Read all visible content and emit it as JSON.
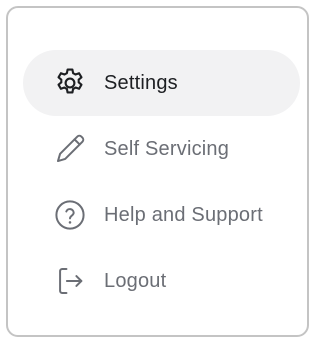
{
  "menu": {
    "items": [
      {
        "label": "Settings",
        "icon": "gear-icon",
        "active": true
      },
      {
        "label": "Self Servicing",
        "icon": "pencil-icon",
        "active": false
      },
      {
        "label": "Help and Support",
        "icon": "question-circle-icon",
        "active": false
      },
      {
        "label": "Logout",
        "icon": "logout-icon",
        "active": false
      }
    ]
  },
  "colors": {
    "active_text": "#1d1f22",
    "inactive_text": "#6b6e75",
    "active_background": "#f2f2f3",
    "border": "#c4c4c4"
  }
}
